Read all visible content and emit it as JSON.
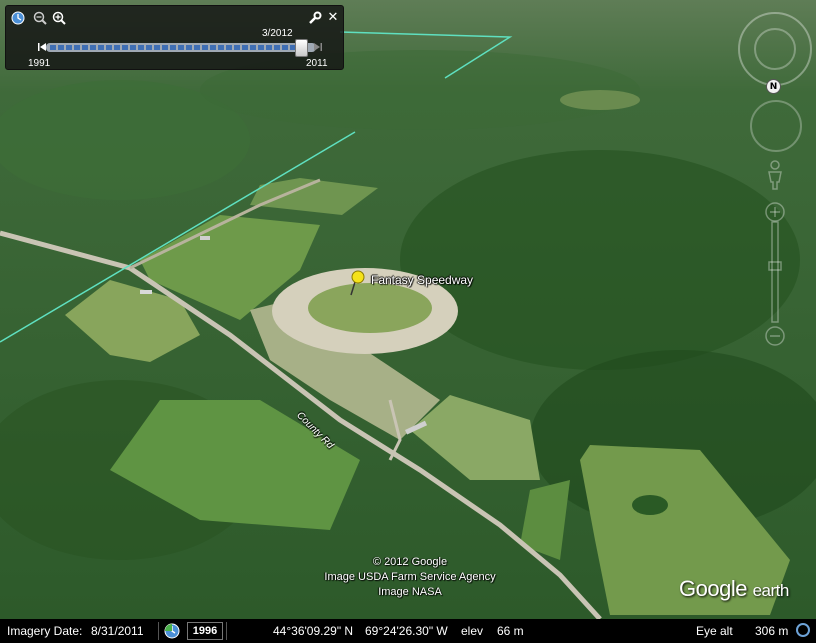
{
  "map": {
    "placemark_label": "Fantasy Speedway",
    "road_label": "County Rd"
  },
  "time_slider": {
    "current_date": "3/2012",
    "start_year": "1991",
    "end_year": "2011",
    "position_fraction": 0.98
  },
  "nav": {
    "north_label": "N"
  },
  "attribution": {
    "lines": [
      "© 2012 Google",
      "Image USDA Farm Service Agency",
      "Image NASA"
    ]
  },
  "logo": {
    "google": "Google",
    "earth": "earth"
  },
  "status_bar": {
    "imagery_date_label": "Imagery Date:",
    "imagery_date_value": "8/31/2011",
    "historical_year": "1996",
    "lat": "44°36'09.29\" N",
    "lon": "69°24'26.30\" W",
    "elev_label": "elev",
    "elev_value": "66 m",
    "eye_alt_label": "Eye alt",
    "eye_alt_value": "306 m"
  },
  "colors": {
    "boundary_line": "#5fe0c0",
    "forest": "#2f5a2c",
    "field": "#6f9a4e",
    "placemark": "#f5e21a"
  }
}
